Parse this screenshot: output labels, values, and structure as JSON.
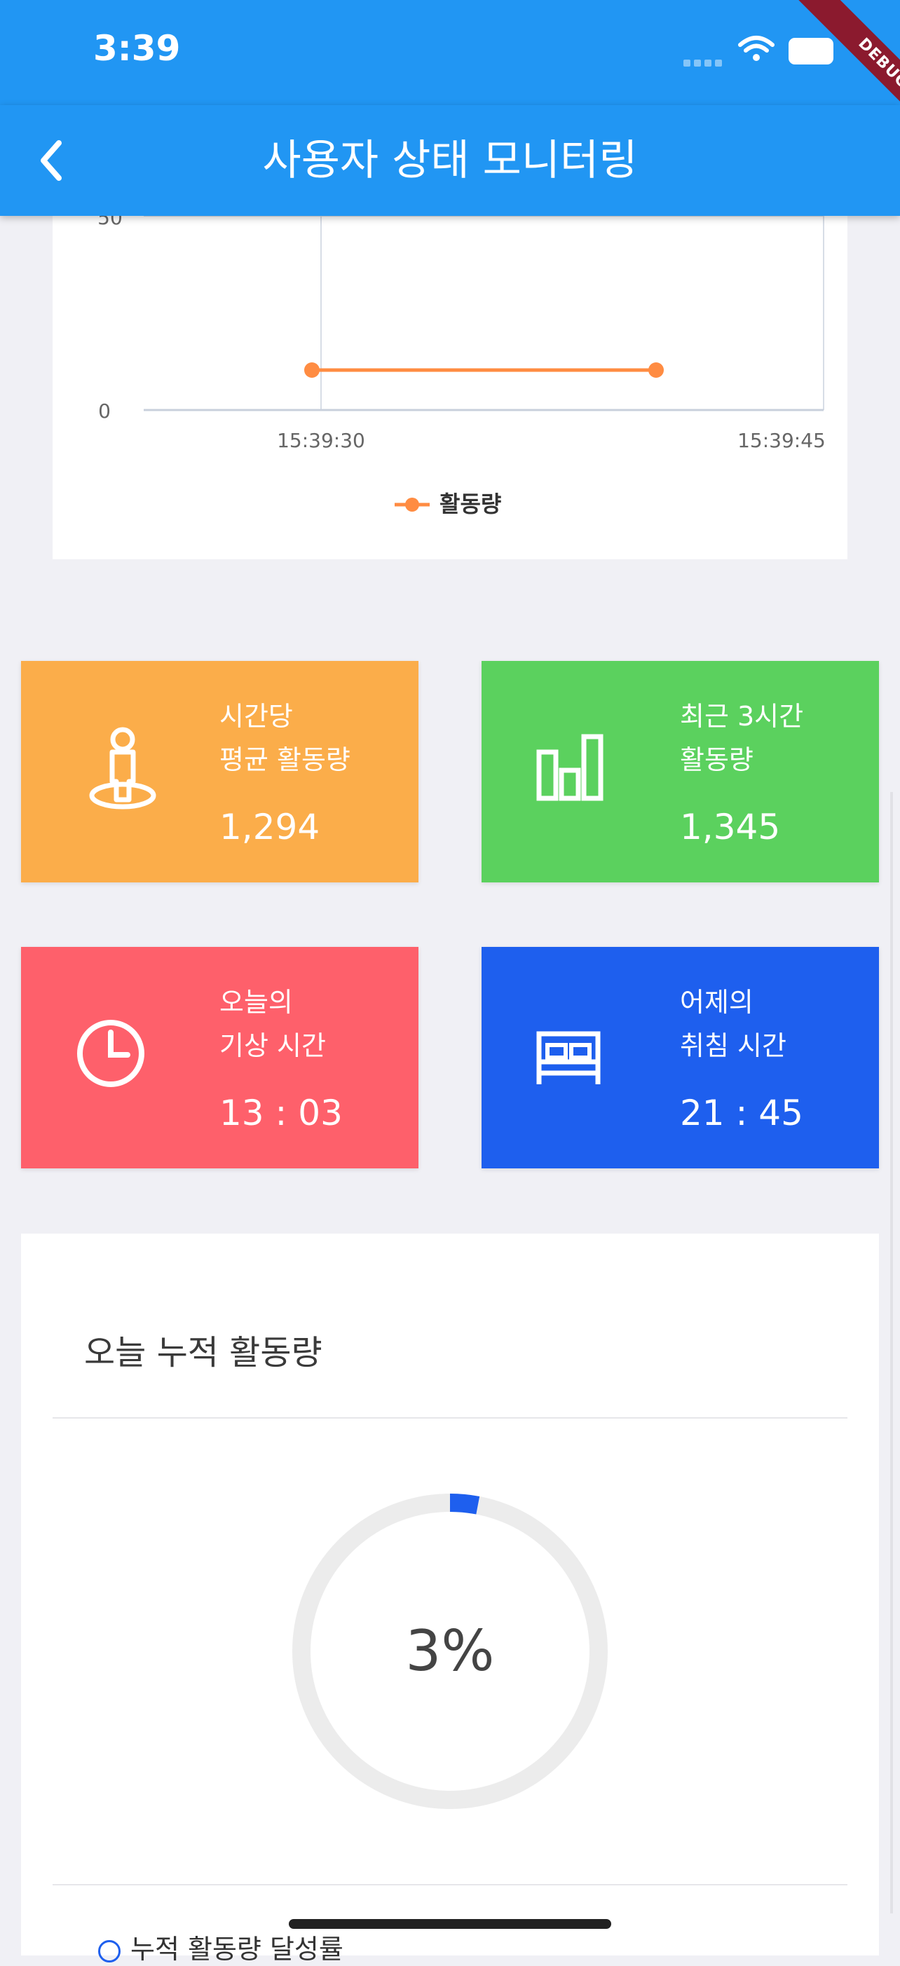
{
  "status_bar": {
    "time": "3:39",
    "debug_label": "DEBUG",
    "icons": [
      "signal-icon",
      "wifi-icon",
      "battery-icon"
    ]
  },
  "app_bar": {
    "title": "사용자 상태 모니터링",
    "back_icon": "chevron-left-icon"
  },
  "chart_data": {
    "type": "line",
    "x": [
      "15:39:30",
      "15:39:45"
    ],
    "y_ticks": [
      "50",
      "0"
    ],
    "ylim": [
      0,
      50
    ],
    "series": [
      {
        "name": "활동량",
        "values": [
          10,
          10
        ],
        "color": "#ff8c42"
      }
    ],
    "legend_position": "bottom-center"
  },
  "tiles": [
    {
      "label_line1": "시간당",
      "label_line2": "평균 활동량",
      "value": "1,294",
      "color": "#fbad4a",
      "icon": "person-pin-icon"
    },
    {
      "label_line1": "최근 3시간",
      "label_line2": "활동량",
      "value": "1,345",
      "color": "#5bd15e",
      "icon": "bar-chart-icon"
    },
    {
      "label_line1": "오늘의",
      "label_line2": "기상 시간",
      "value": "13 : 03",
      "color": "#fe606b",
      "icon": "clock-icon"
    },
    {
      "label_line1": "어제의",
      "label_line2": "취침 시간",
      "value": "21 : 45",
      "color": "#1e5fee",
      "icon": "bed-icon"
    }
  ],
  "summary": {
    "title": "오늘 누적 활동량",
    "progress_percent": 3,
    "progress_label": "3%",
    "progress_color": "#1e5fee",
    "legend_label": "누적 활동량 달성률"
  }
}
